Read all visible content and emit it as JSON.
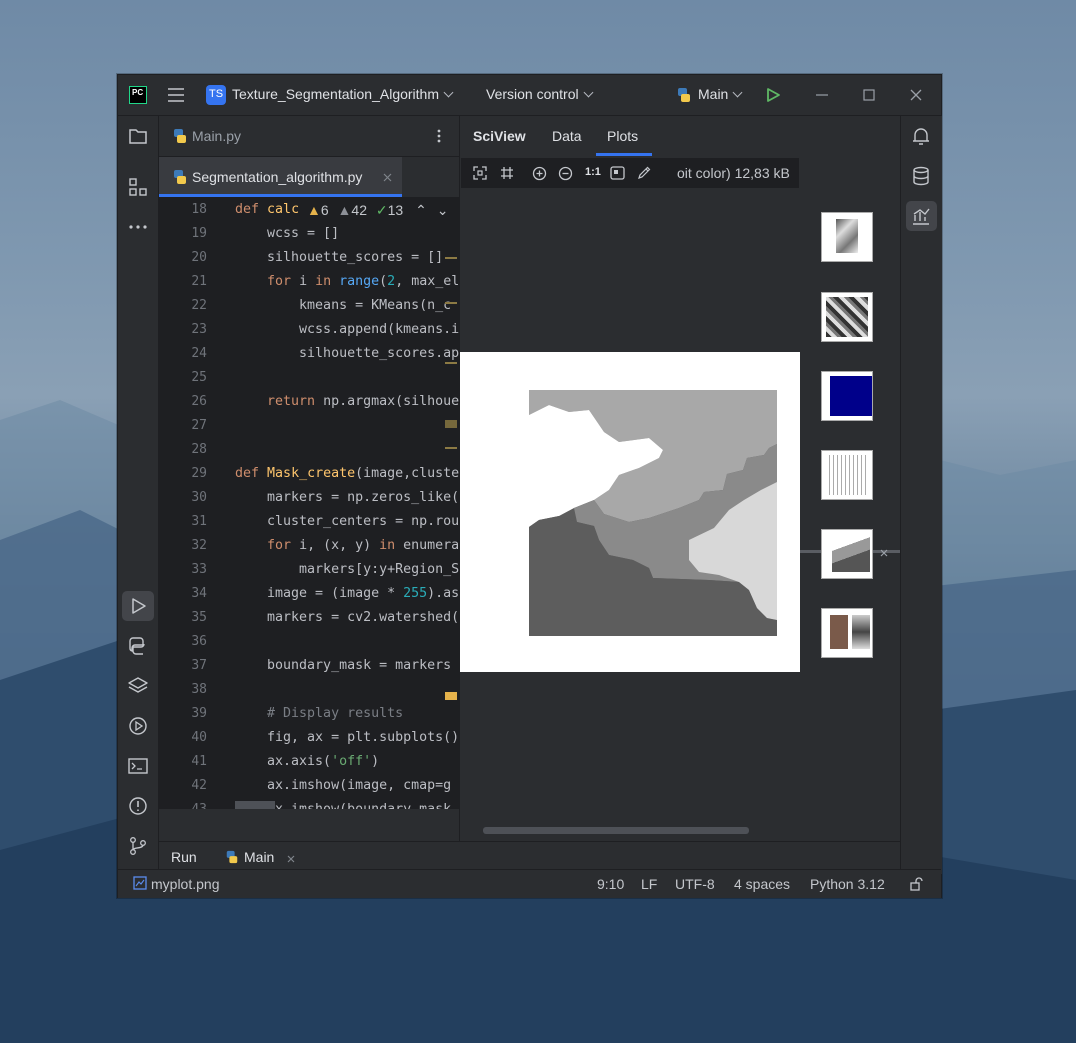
{
  "titlebar": {
    "logo": "PC",
    "project_badge": "TS",
    "project_name": "Texture_Segmentation_Algorithm",
    "vcs": "Version control",
    "run_config": "Main"
  },
  "tabs": {
    "first": "Main.py",
    "second": "Segmentation_algorithm.py"
  },
  "inspections": {
    "warnings": "6",
    "weak": "42",
    "ok": "13"
  },
  "code_lines": [
    {
      "n": "18",
      "text": "def calc"
    },
    {
      "n": "19",
      "text": "    wcss = []"
    },
    {
      "n": "20",
      "text": "    silhouette_scores = []"
    },
    {
      "n": "21",
      "text": "    for i in range(2, max_el"
    },
    {
      "n": "22",
      "text": "        kmeans = KMeans(n_c"
    },
    {
      "n": "23",
      "text": "        wcss.append(kmeans.i"
    },
    {
      "n": "24",
      "text": "        silhouette_scores.ap"
    },
    {
      "n": "25",
      "text": ""
    },
    {
      "n": "26",
      "text": "    return np.argmax(silhoue"
    },
    {
      "n": "27",
      "text": ""
    },
    {
      "n": "28",
      "text": ""
    },
    {
      "n": "29",
      "text": "def Mask_create(image,cluste"
    },
    {
      "n": "30",
      "text": "    markers = np.zeros_like("
    },
    {
      "n": "31",
      "text": "    cluster_centers = np.rou"
    },
    {
      "n": "32",
      "text": "    for i, (x, y) in enumera"
    },
    {
      "n": "33",
      "text": "        markers[y:y+Region_S"
    },
    {
      "n": "34",
      "text": "    image = (image * 255).as"
    },
    {
      "n": "35",
      "text": "    markers = cv2.watershed("
    },
    {
      "n": "36",
      "text": ""
    },
    {
      "n": "37",
      "text": "    boundary_mask = markers "
    },
    {
      "n": "38",
      "text": ""
    },
    {
      "n": "39",
      "text": "    # Display results"
    },
    {
      "n": "40",
      "text": "    fig, ax = plt.subplots()"
    },
    {
      "n": "41",
      "text": "    ax.axis('off')"
    },
    {
      "n": "42",
      "text": "    ax.imshow(image, cmap=g"
    },
    {
      "n": "43",
      "text": "    ax.imshow(boundary_mask"
    }
  ],
  "sciview": {
    "tabs": [
      "SciView",
      "Data",
      "Plots"
    ],
    "active_tab": "Plots",
    "zoom_label": "1:1",
    "image_info": "oit color) 12,83 kB"
  },
  "bottom": {
    "run_label": "Run",
    "run_tab": "Main"
  },
  "status": {
    "file": "myplot.png",
    "position": "9:10",
    "line_sep": "LF",
    "encoding": "UTF-8",
    "indent": "4 spaces",
    "interpreter": "Python 3.12"
  },
  "colors": {
    "accent": "#3574f0",
    "run_green": "#5fb865",
    "bg_dark": "#2b2d30",
    "editor_bg": "#1e1f22"
  }
}
